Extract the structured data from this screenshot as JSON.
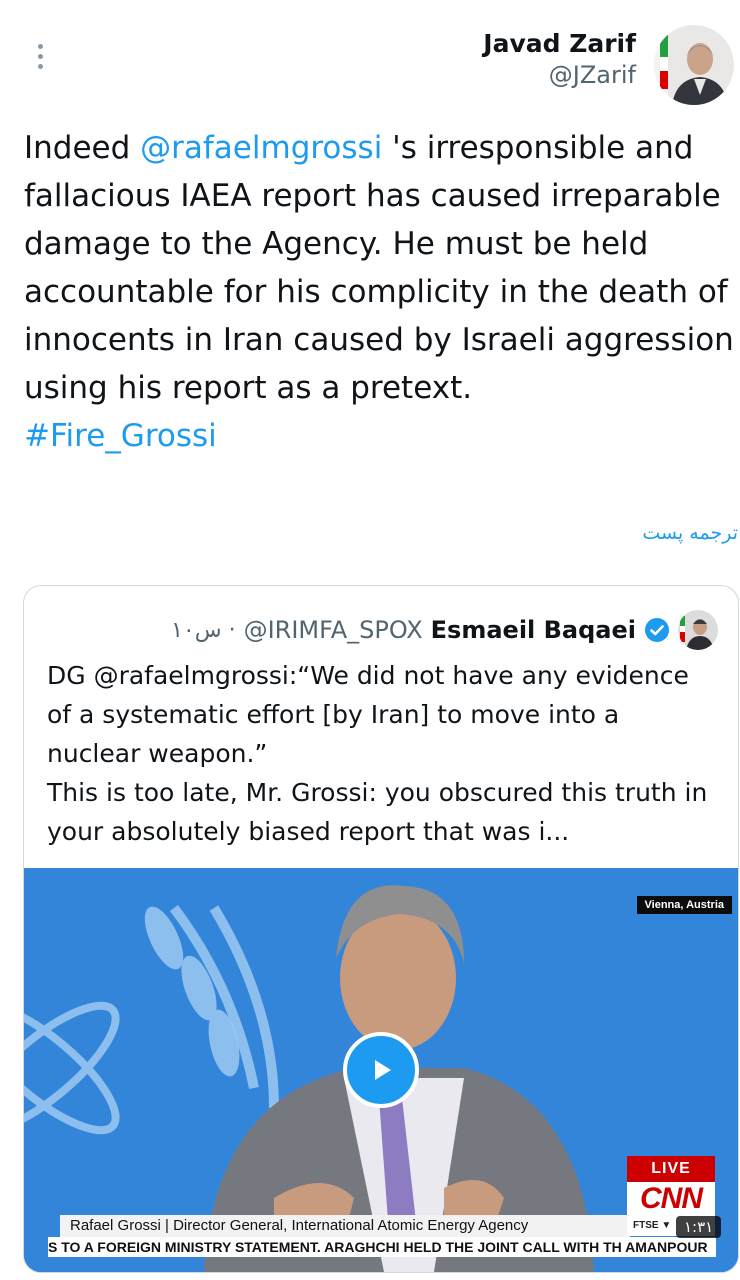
{
  "tweet": {
    "author_name": "Javad Zarif",
    "author_handle": "@JZarif",
    "text_before": "Indeed ",
    "mention": "@rafaelmgrossi",
    "text_after": " 's irresponsible and fallacious IAEA report has caused irreparable damage to the Agency. He must be held accountable for his complicity in the death of innocents in Iran caused by Israeli aggression using his report as a pretext.",
    "hashtag": "#Fire_Grossi",
    "translate_label": "ترجمه پست"
  },
  "quote": {
    "author_name": "Esmaeil Baqaei",
    "author_handle": "@IRIMFA_SPOX",
    "time": "۱۰س ·",
    "text_line1": "DG @rafaelmgrossi:“We did not have any evidence of a systematic effort [by Iran] to move into a nuclear weapon.”",
    "text_line2": "This is too late, Mr. Grossi: you obscured this truth in your absolutely biased report that was i...",
    "video": {
      "location": "Vienna, Austria",
      "live_label": "LIVE",
      "network": "CNN",
      "lower_third": "Rafael Grossi  |  Director General, International Atomic Energy Agency",
      "ftse": "FTSE ▼",
      "ticker": "S TO A FOREIGN MINISTRY STATEMENT. ARAGHCHI HELD THE JOINT CALL WITH TH AMANPOUR",
      "duration": "۱:۳۱"
    }
  },
  "colors": {
    "link": "#1d9bf0",
    "secondary": "#536471",
    "video_bg": "#2f80d4",
    "cnn_red": "#cc0000"
  },
  "icons": [
    "more-vertical-icon",
    "verified-badge-icon",
    "play-icon"
  ]
}
